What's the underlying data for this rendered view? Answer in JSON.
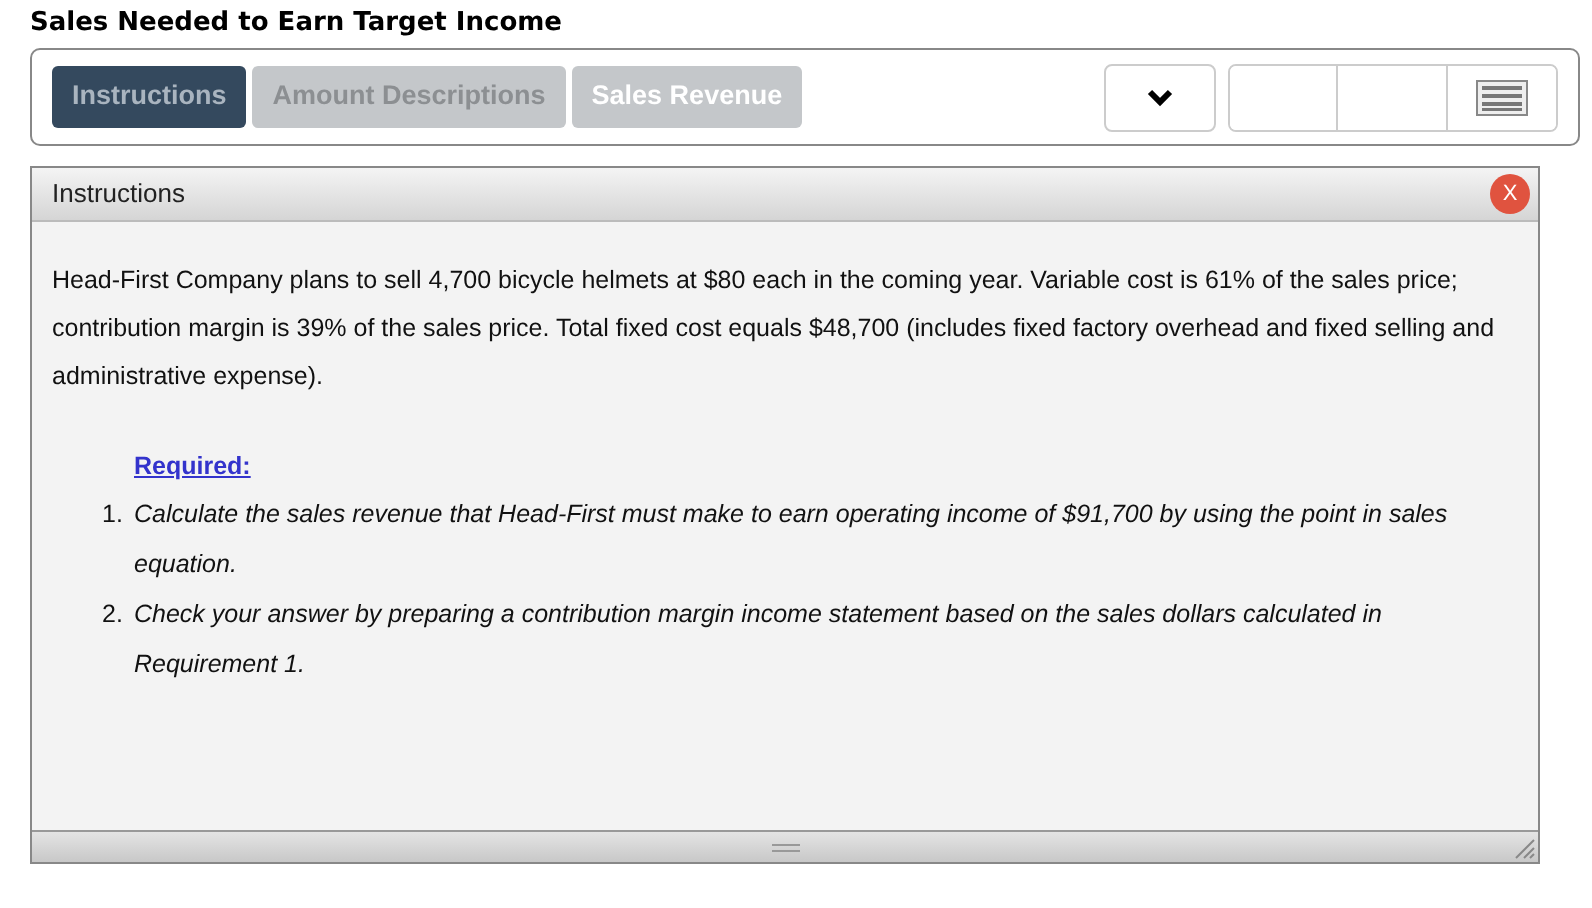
{
  "title": "Sales Needed to Earn Target Income",
  "tabs": [
    {
      "label": "Instructions",
      "selected": true,
      "kind": "plain"
    },
    {
      "label": "Amount Descriptions",
      "selected": false,
      "kind": "plain"
    },
    {
      "label": "Sales Revenue",
      "selected": false,
      "kind": "bright"
    }
  ],
  "panel": {
    "title": "Instructions",
    "close_label": "X",
    "intro": "Head-First Company plans to sell 4,700 bicycle helmets at $80 each in the coming year. Variable cost is 61% of the sales price; contribution margin is 39% of the sales price. Total fixed cost equals $48,700 (includes fixed factory overhead and fixed selling and administrative expense).",
    "required_label": "Required:",
    "requirements": [
      {
        "number": "1.",
        "text": "Calculate the sales revenue that Head-First must make to earn operating income of $91,700 by using the point in sales equation."
      },
      {
        "number": "2.",
        "text": "Check your answer by preparing a contribution margin income statement based on the sales dollars calculated in Requirement 1."
      }
    ]
  }
}
